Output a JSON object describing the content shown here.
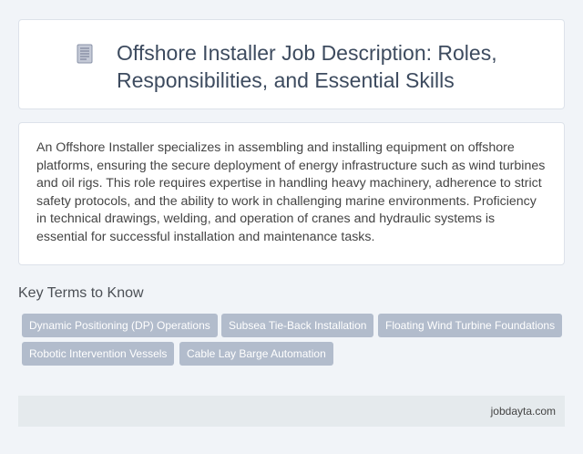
{
  "header": {
    "icon": "document-icon",
    "title": "Offshore Installer Job Description: Roles, Responsibilities, and Essential Skills"
  },
  "description": "An Offshore Installer specializes in assembling and installing equipment on offshore platforms, ensuring the secure deployment of energy infrastructure such as wind turbines and oil rigs. This role requires expertise in handling heavy machinery, adherence to strict safety protocols, and the ability to work in challenging marine environments. Proficiency in technical drawings, welding, and operation of cranes and hydraulic systems is essential for successful installation and maintenance tasks.",
  "key_terms": {
    "heading": "Key Terms to Know",
    "tags": [
      "Dynamic Positioning (DP) Operations",
      "Subsea Tie-Back Installation",
      "Floating Wind Turbine Foundations",
      "Robotic Intervention Vessels",
      "Cable Lay Barge Automation"
    ]
  },
  "footer": {
    "site": "jobdayta.com"
  },
  "colors": {
    "page_background": "#f1f4f8",
    "tag_background": "#b2bccc",
    "footer_background": "#e5eaed",
    "title_text": "#3d4b5f"
  }
}
